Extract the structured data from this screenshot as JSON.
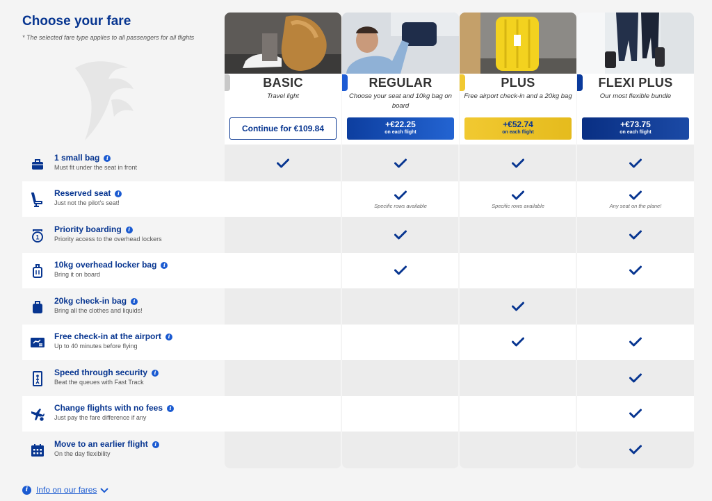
{
  "header": {
    "title": "Choose your fare",
    "subtitle": "* The selected fare type applies to all passengers for all flights"
  },
  "fares": [
    {
      "id": "basic",
      "name": "BASIC",
      "description": "Travel light",
      "cta": "Continue for €109.84",
      "accent": "#c8c8c8"
    },
    {
      "id": "regular",
      "name": "REGULAR",
      "description": "Choose your seat and 10kg bag on board",
      "price": "+€22.25",
      "price_sub": "on each flight",
      "accent": "#1d5bd4"
    },
    {
      "id": "plus",
      "name": "PLUS",
      "description": "Free airport check-in and a 20kg bag",
      "price": "+€52.74",
      "price_sub": "on each flight",
      "accent": "#f1c931"
    },
    {
      "id": "flexi",
      "name": "FLEXI PLUS",
      "description": "Our most flexible bundle",
      "price": "+€73.75",
      "price_sub": "on each flight",
      "accent": "#0a3a9c"
    }
  ],
  "features": [
    {
      "title": "1 small bag",
      "subtitle": "Must fit under the seat in front",
      "icon": "small-bag-icon",
      "included": [
        true,
        true,
        true,
        true
      ]
    },
    {
      "title": "Reserved seat",
      "subtitle": "Just not the pilot's seat!",
      "icon": "seat-icon",
      "included": [
        false,
        true,
        true,
        true
      ],
      "notes": [
        "",
        "Specific rows available",
        "Specific rows available",
        "Any seat on the plane!"
      ]
    },
    {
      "title": "Priority boarding",
      "subtitle": "Priority access to the overhead lockers",
      "icon": "priority-icon",
      "included": [
        false,
        true,
        false,
        true
      ]
    },
    {
      "title": "10kg overhead locker bag",
      "subtitle": "Bring it on board",
      "icon": "cabin-bag-icon",
      "included": [
        false,
        true,
        false,
        true
      ]
    },
    {
      "title": "20kg check-in bag",
      "subtitle": "Bring all the clothes and liquids!",
      "icon": "checked-bag-icon",
      "included": [
        false,
        false,
        true,
        false
      ]
    },
    {
      "title": "Free check-in at the airport",
      "subtitle": "Up to 40 minutes before flying",
      "icon": "check-in-icon",
      "included": [
        false,
        false,
        true,
        true
      ]
    },
    {
      "title": "Speed through security",
      "subtitle": "Beat the queues with Fast Track",
      "icon": "fast-track-icon",
      "included": [
        false,
        false,
        false,
        true
      ]
    },
    {
      "title": "Change flights with no fees",
      "subtitle": "Just pay the fare difference if any",
      "icon": "plane-change-icon",
      "included": [
        false,
        false,
        false,
        true
      ]
    },
    {
      "title": "Move to an earlier flight",
      "subtitle": "On the day flexibility",
      "icon": "calendar-icon",
      "included": [
        false,
        false,
        false,
        true
      ]
    }
  ],
  "footer": {
    "link": "Info on our fares"
  },
  "colors": {
    "brand": "#073590",
    "accent_blue": "#1a5ad1",
    "yellow": "#f1c931"
  }
}
